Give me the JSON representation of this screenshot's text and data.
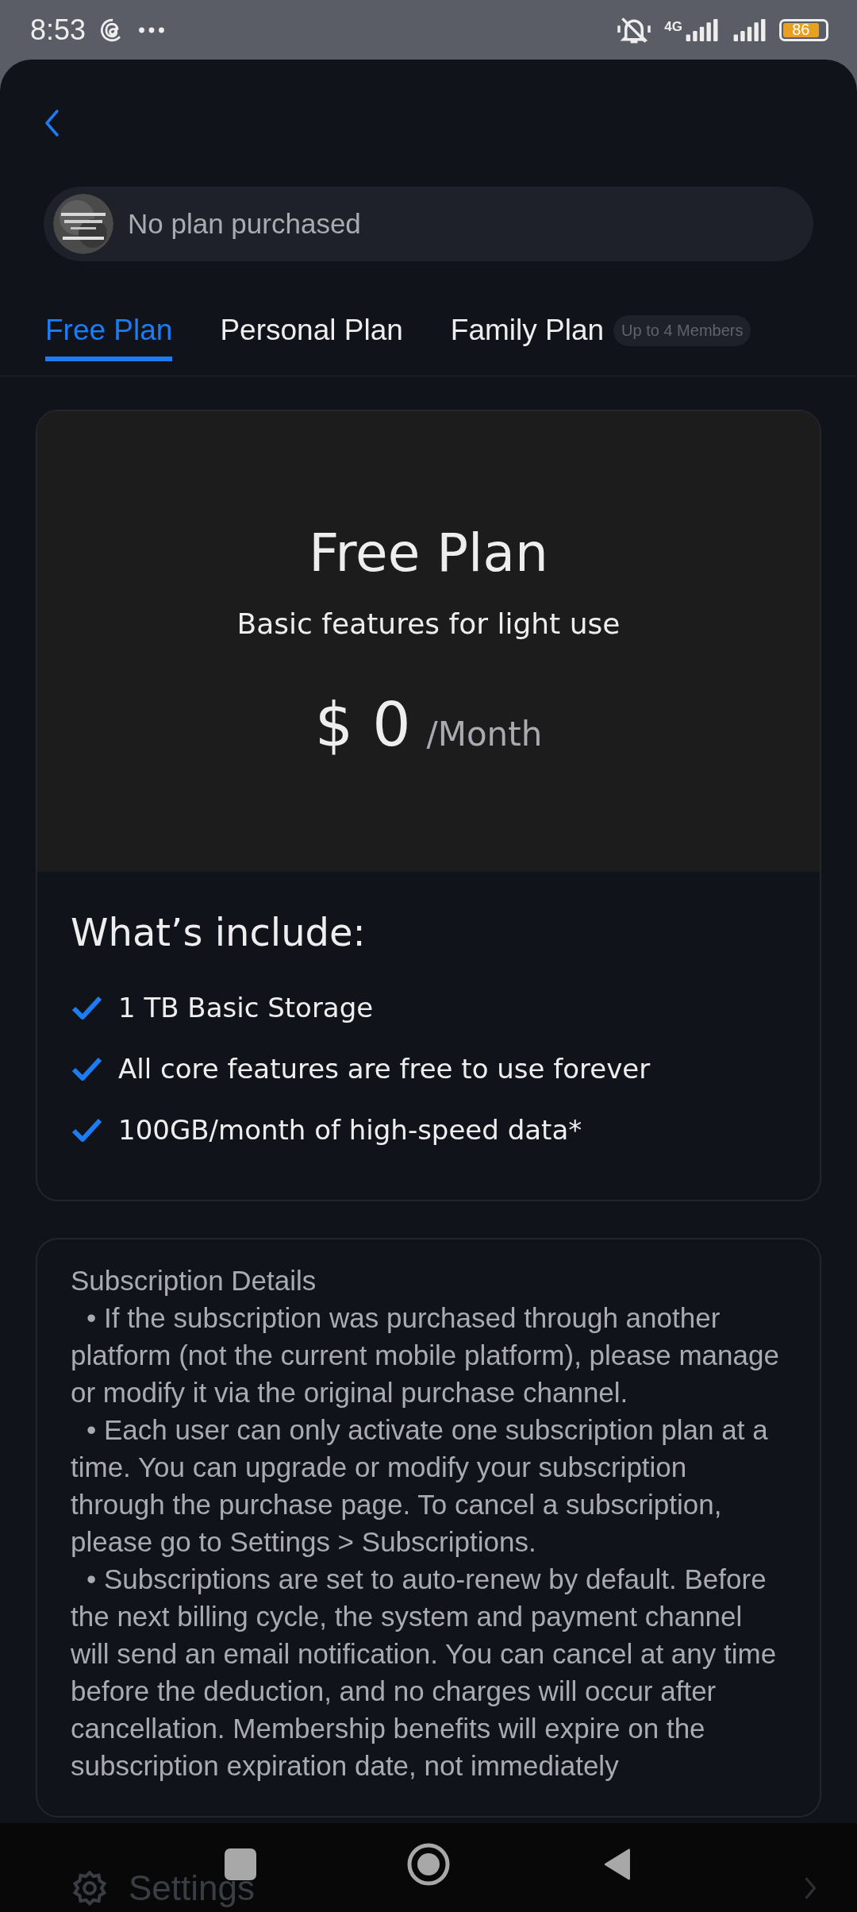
{
  "status_bar": {
    "time": "8:53",
    "network": "4G",
    "battery": "86"
  },
  "plan_status": {
    "text": "No plan purchased"
  },
  "tabs": [
    {
      "label": "Free Plan",
      "selected": true
    },
    {
      "label": "Personal Plan",
      "selected": false
    },
    {
      "label": "Family Plan",
      "selected": false,
      "badge": "Up to 4 Members"
    }
  ],
  "plan_card": {
    "title": "Free Plan",
    "subtitle": "Basic features for light use",
    "currency": "$",
    "price": "0",
    "period": "/Month",
    "includes_title": "What’s include:",
    "features": [
      "1 TB Basic Storage",
      "All core features are free to use forever",
      "100GB/month of high-speed data*"
    ]
  },
  "details": {
    "title": "Subscription Details",
    "paragraphs": [
      "•  If the subscription was purchased through another platform (not the current mobile platform), please manage or modify it via the original purchase channel.",
      "•  Each user can only activate one subscription plan at a time. You can upgrade or modify your subscription through the purchase page. To cancel a subscription, please go to Settings > Subscriptions.",
      "•  Subscriptions are set to auto-renew by default. Before the next billing cycle, the system and payment channel will send an email notification. You can cancel at any time before the deduction, and no charges will occur after cancellation. Membership benefits will expire on the subscription expiration date, not immediately"
    ]
  },
  "background_row": {
    "label": "Settings"
  }
}
